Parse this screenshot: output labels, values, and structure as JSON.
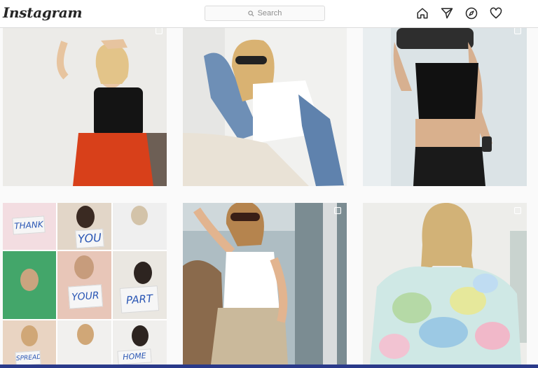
{
  "header": {
    "logo": "Instagram",
    "search_placeholder": "Search",
    "icons": [
      "home-icon",
      "direct-icon",
      "explore-icon",
      "activity-icon"
    ]
  },
  "grid": {
    "collage_signs": [
      "THANK",
      "YOU",
      "YOUR",
      "PART",
      "SPREAD",
      "HOME"
    ]
  },
  "colors": {
    "accent_border": "#dbdbdb",
    "text_primary": "#262626",
    "placeholder": "#8e8e8e"
  }
}
